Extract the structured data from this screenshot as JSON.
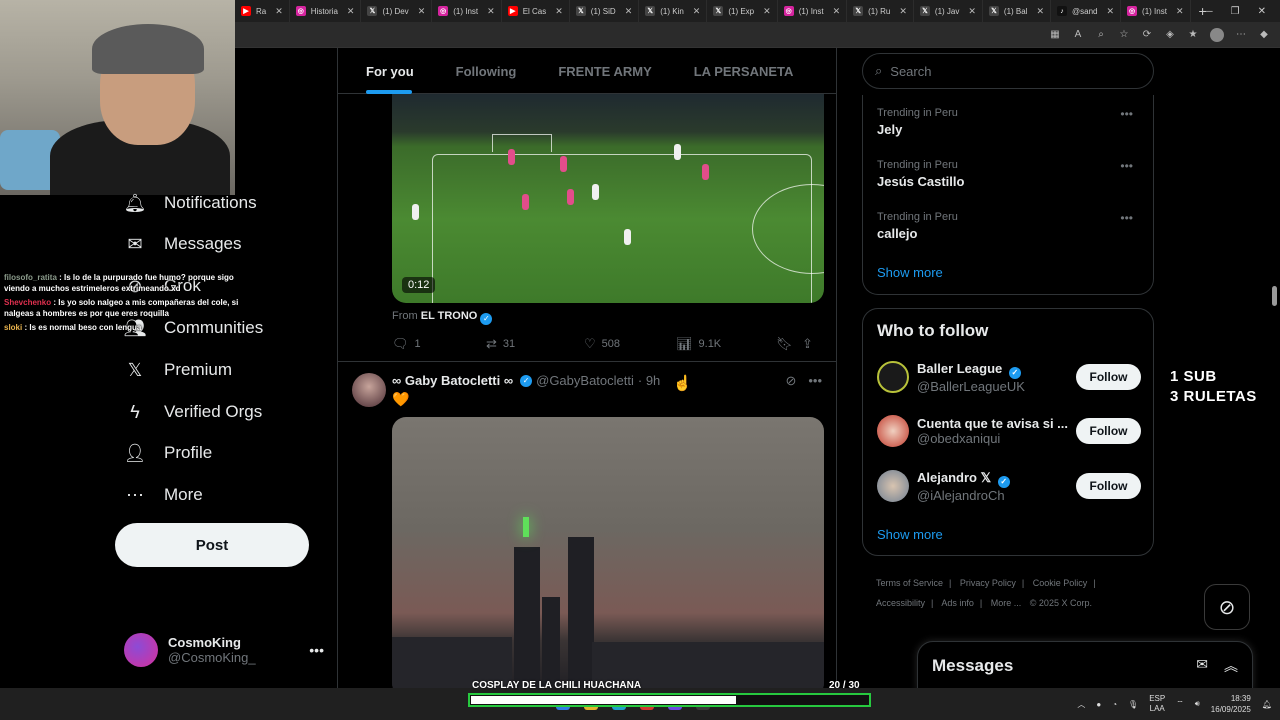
{
  "browser": {
    "tabs": [
      {
        "label": "Ra",
        "icon": "youtube-icon",
        "color": "#ff0000"
      },
      {
        "label": "Historia",
        "icon": "instagram-icon",
        "color": "#d6249f"
      },
      {
        "label": "(1) Dev",
        "icon": "x-icon",
        "color": "#444444"
      },
      {
        "label": "(1) Inst",
        "icon": "instagram-icon",
        "color": "#d6249f"
      },
      {
        "label": "El Cas",
        "icon": "youtube-icon",
        "color": "#ff0000"
      },
      {
        "label": "(1) SiD",
        "icon": "x-icon",
        "color": "#444444"
      },
      {
        "label": "(1) Kin",
        "icon": "x-icon",
        "color": "#444444"
      },
      {
        "label": "(1) Exp",
        "icon": "x-icon",
        "color": "#444444"
      },
      {
        "label": "(1) Inst",
        "icon": "instagram-icon",
        "color": "#d6249f"
      },
      {
        "label": "(1) Ru",
        "icon": "x-icon",
        "color": "#444444"
      },
      {
        "label": "(1) Jav",
        "icon": "x-icon",
        "color": "#444444"
      },
      {
        "label": "(1) Bal",
        "icon": "x-icon",
        "color": "#444444"
      },
      {
        "label": "@sand",
        "icon": "tiktok-icon",
        "color": "#111111"
      },
      {
        "label": "(1) Inst",
        "icon": "instagram-icon",
        "color": "#d6249f"
      }
    ]
  },
  "nav": {
    "items": [
      {
        "label": "Notifications",
        "icon": "bell-icon"
      },
      {
        "label": "Messages",
        "icon": "envelope-icon"
      },
      {
        "label": "Grok",
        "icon": "grok-icon"
      },
      {
        "label": "Communities",
        "icon": "communities-icon"
      },
      {
        "label": "Premium",
        "icon": "x-logo-icon"
      },
      {
        "label": "Verified Orgs",
        "icon": "lightning-icon"
      },
      {
        "label": "Profile",
        "icon": "person-icon"
      },
      {
        "label": "More",
        "icon": "more-circle-icon"
      }
    ],
    "post_label": "Post",
    "account": {
      "name": "CosmoKing",
      "handle": "@CosmoKing_"
    }
  },
  "chat": [
    {
      "user": "filosofo_ratita",
      "text": "Is lo de la purpurado fue humo? porque sigo viendo a muchos estrimeleros extrimeando xd"
    },
    {
      "user": "Shevchenko",
      "text": "Is yo solo nalgeo a mis compañeras del cole, si nalgeas a hombres es por que eres roquilla"
    },
    {
      "user": "sloki",
      "text": "Is es normal beso con lengua"
    }
  ],
  "feed": {
    "tabs": [
      "For you",
      "Following",
      "FRENTE ARMY",
      "LA PERSANETA"
    ],
    "active_tab": "For you",
    "tweet1": {
      "video_time": "0:12",
      "from_prefix": "From",
      "from_name": "EL TRONO",
      "replies": "1",
      "reposts": "31",
      "likes": "508",
      "views": "9.1K"
    },
    "tweet2": {
      "name": "∞ Gaby Batocletti ∞",
      "handle": "@GabyBatocletti",
      "time": "· 9h",
      "text": "🧡"
    }
  },
  "right": {
    "search_placeholder": "Search",
    "trends": [
      {
        "meta": "Trending in Peru",
        "name": "Jely"
      },
      {
        "meta": "Trending in Peru",
        "name": "Jesús Castillo"
      },
      {
        "meta": "Trending in Peru",
        "name": "callejo"
      }
    ],
    "show_more": "Show more",
    "who_to_follow_title": "Who to follow",
    "who_to_follow": [
      {
        "name": "Baller League",
        "handle": "@BallerLeagueUK",
        "verified": true,
        "avatar_color": "#1a1a1a"
      },
      {
        "name": "Cuenta que te avisa si ...",
        "handle": "@obedxaniqui",
        "verified": false,
        "avatar_color": "#c0392b"
      },
      {
        "name": "Alejandro 𝕏",
        "handle": "@iAlejandroCh",
        "verified": true,
        "avatar_color": "#6f7f92"
      }
    ],
    "follow_label": "Follow",
    "show_more_2": "Show more",
    "footer": [
      "Terms of Service",
      "|",
      "Privacy Policy",
      "|",
      "Cookie Policy",
      "|",
      "Accessibility",
      "|",
      "Ads info",
      "|",
      "More ...",
      "© 2025 X Corp."
    ],
    "messages_title": "Messages"
  },
  "overlay": {
    "promo_line1": "1 SUB",
    "promo_line2": "3 RULETAS",
    "goal_label": "COSPLAY DE LA CHILI HUACHANA",
    "goal_count": "20  / 30",
    "goal_progress": 0.667
  },
  "taskbar": {
    "lang_top": "ESP",
    "lang_bottom": "LAA",
    "time": "18:39",
    "date": "16/09/2025"
  },
  "colors": {
    "accent": "#1d9bf0",
    "background": "#000000",
    "goal_border": "#27c93f"
  }
}
